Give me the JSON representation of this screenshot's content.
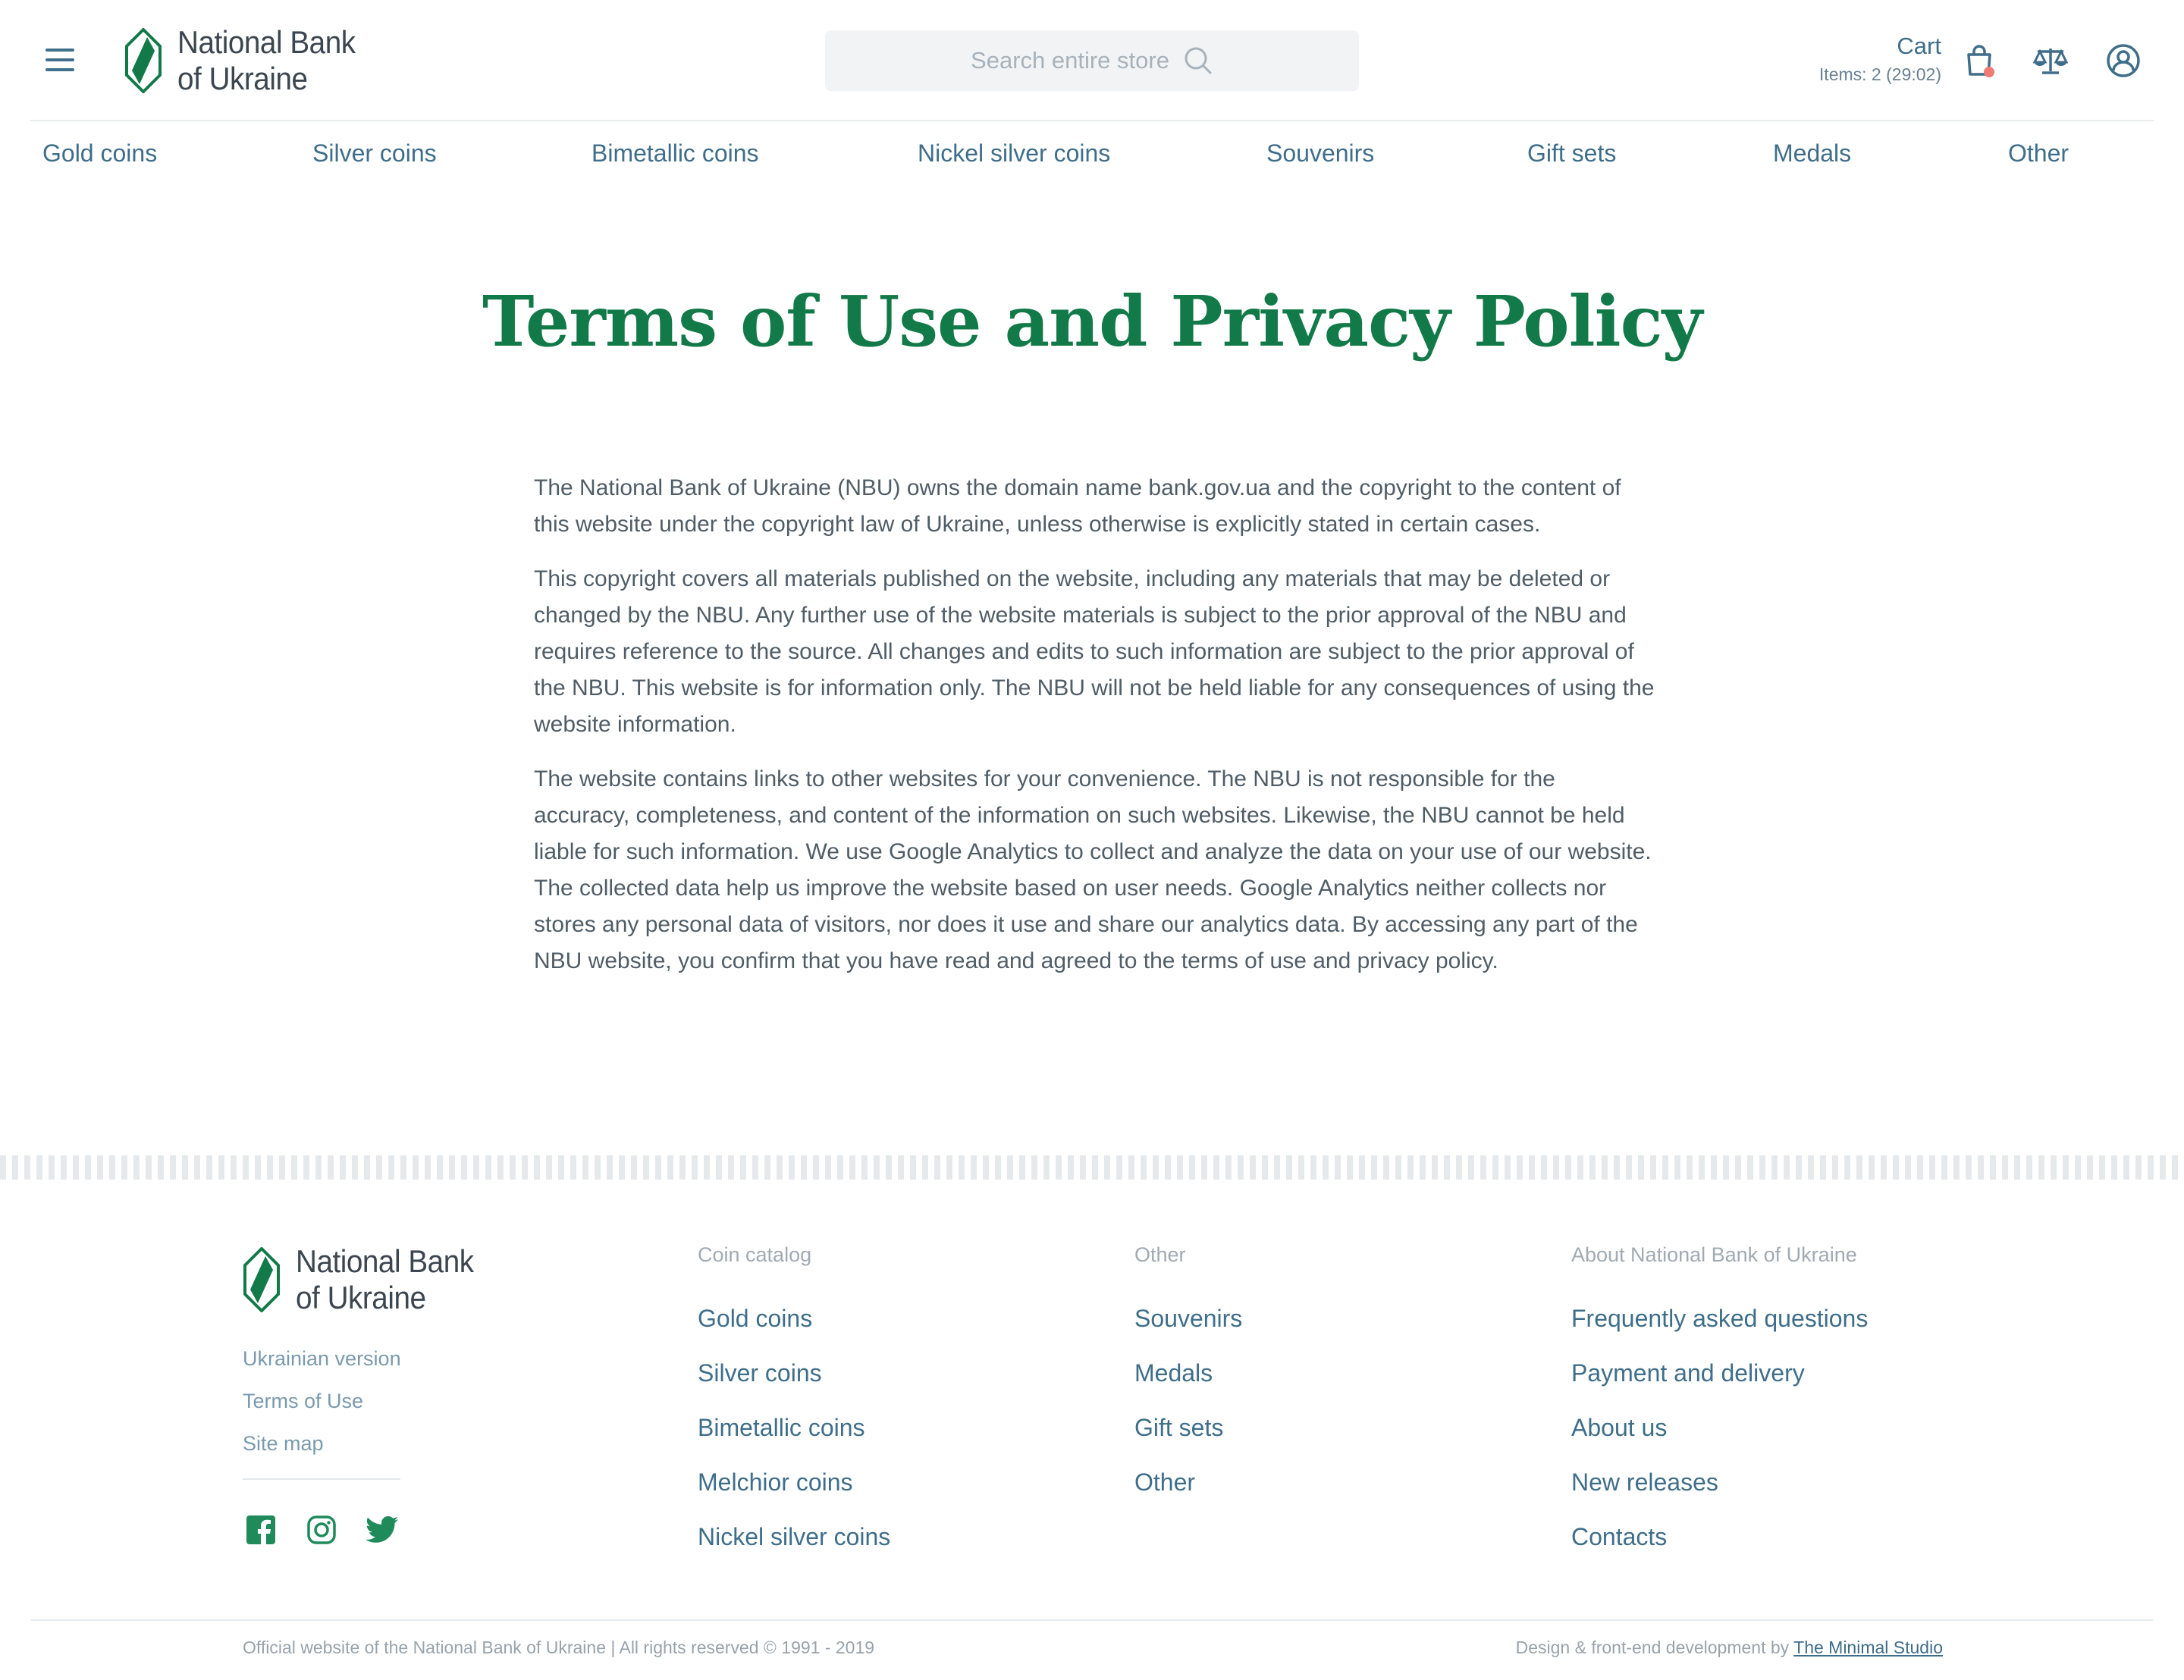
{
  "brand": {
    "line1": "National Bank",
    "line2": "of Ukraine",
    "color": "#127a48"
  },
  "header": {
    "search_placeholder": "Search entire store",
    "cart_title": "Cart",
    "cart_items": "Items: 2 (29:02)"
  },
  "nav": {
    "items": [
      "Gold coins",
      "Silver coins",
      "Bimetallic coins",
      "Nickel silver coins",
      "Souvenirs",
      "Gift sets",
      "Medals",
      "Other"
    ]
  },
  "main": {
    "title": "Terms of Use and Privacy Policy",
    "paragraphs": [
      "The National Bank of Ukraine (NBU) owns the domain name bank.gov.ua and the copyright to the content of this website under the copyright law of Ukraine, unless otherwise is explicitly stated in certain cases.",
      "This copyright covers all materials published on the website, including any materials that may be deleted or changed by the NBU. Any further use of the website materials is subject to the prior approval of the NBU and requires reference to the source. All changes and edits to such information are subject to the prior approval of the NBU. This website is for information only. The NBU will not be held liable for any consequences of using the website information.",
      "The website contains links to other websites for your convenience. The NBU is not responsible for the accuracy, completeness, and content of the information on such websites. Likewise, the NBU cannot be held liable for such information. We use Google Analytics to collect and analyze the data on your use of our website. The collected data help us improve the website based on user needs. Google Analytics neither collects nor stores any personal data of visitors, nor does it use and share our analytics data. By accessing any part of the NBU website, you confirm that you have read and agreed to the terms of use and privacy policy."
    ]
  },
  "footer": {
    "links": [
      "Ukrainian version",
      "Terms of Use",
      "Site map"
    ],
    "social": [
      "facebook-icon",
      "instagram-icon",
      "twitter-icon"
    ],
    "columns": [
      {
        "heading": "Coin catalog",
        "items": [
          "Gold coins",
          "Silver coins",
          "Bimetallic coins",
          "Melchior coins",
          "Nickel silver coins"
        ]
      },
      {
        "heading": "Other",
        "items": [
          "Souvenirs",
          "Medals",
          "Gift sets",
          "Other"
        ]
      },
      {
        "heading": "About National Bank of Ukraine",
        "items": [
          "Frequently asked questions",
          "Payment and delivery",
          "About us",
          "New releases",
          "Contacts"
        ]
      }
    ],
    "copyright": "Official website of the National Bank of Ukraine | All rights reserved © 1991 - 2019",
    "credit_prefix": "Design & front-end development by",
    "credit_link": "The Minimal Studio"
  },
  "colors": {
    "accent": "#3f6e8a",
    "title_green": "#127a48",
    "notification_dot": "#f07a74"
  }
}
